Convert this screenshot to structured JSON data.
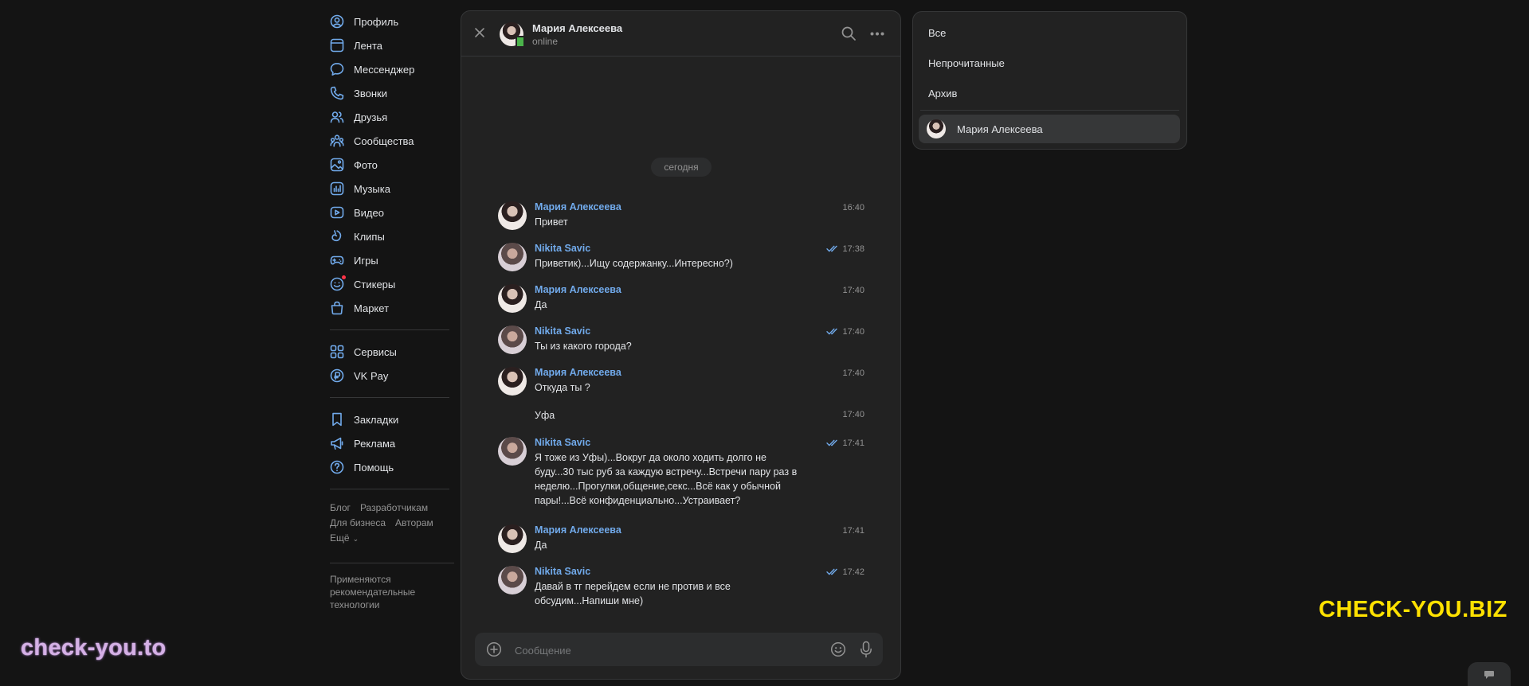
{
  "nav": {
    "items": [
      {
        "label": "Профиль",
        "icon": "profile-icon"
      },
      {
        "label": "Лента",
        "icon": "feed-icon"
      },
      {
        "label": "Мессенджер",
        "icon": "messenger-icon"
      },
      {
        "label": "Звонки",
        "icon": "phone-icon"
      },
      {
        "label": "Друзья",
        "icon": "friends-icon"
      },
      {
        "label": "Сообщества",
        "icon": "communities-icon"
      },
      {
        "label": "Фото",
        "icon": "photo-icon"
      },
      {
        "label": "Музыка",
        "icon": "music-icon"
      },
      {
        "label": "Видео",
        "icon": "video-icon"
      },
      {
        "label": "Клипы",
        "icon": "clips-icon"
      },
      {
        "label": "Игры",
        "icon": "games-icon"
      },
      {
        "label": "Стикеры",
        "icon": "stickers-icon"
      },
      {
        "label": "Маркет",
        "icon": "market-icon"
      }
    ],
    "items2": [
      {
        "label": "Сервисы",
        "icon": "services-icon"
      },
      {
        "label": "VK Pay",
        "icon": "vkpay-icon"
      }
    ],
    "items3": [
      {
        "label": "Закладки",
        "icon": "bookmark-icon"
      },
      {
        "label": "Реклама",
        "icon": "megaphone-icon"
      },
      {
        "label": "Помощь",
        "icon": "help-icon"
      }
    ],
    "footer": {
      "blog": "Блог",
      "developers": "Разработчикам",
      "business": "Для бизнеса",
      "authors": "Авторам",
      "more": "Ещё"
    },
    "recommend_note": "Применяются рекомендательные технологии"
  },
  "chat": {
    "contact_name": "Мария Алексеева",
    "status": "online",
    "date_label": "сегодня",
    "messages": [
      {
        "author": "Мария Алексеева",
        "text": "Привет",
        "time": "16:40"
      },
      {
        "author": "Nikita Savic",
        "text": "Приветик)...Ищу содержанку...Интересно?)",
        "time": "17:38"
      },
      {
        "author": "Мария Алексеева",
        "text": "Да",
        "time": "17:40"
      },
      {
        "author": "Nikita Savic",
        "text": "Ты из какого города?",
        "time": "17:40"
      },
      {
        "author": "Мария Алексеева",
        "text": "Откуда ты ?",
        "time": "17:40"
      },
      {
        "author": "",
        "text": "Уфа",
        "time": "17:40"
      },
      {
        "author": "Nikita Savic",
        "text": "Я тоже из Уфы)...Вокруг да около ходить долго не буду...30 тыс руб за каждую встречу...Встречи пару раз в неделю...Прогулки,общение,секс...Всё как у обычной пары!...Всё конфиденциально...Устраивает?",
        "time": "17:41"
      },
      {
        "author": "Мария Алексеева",
        "text": "Да",
        "time": "17:41"
      },
      {
        "author": "Nikita Savic",
        "text": "Давай в тг перейдем если не против и все обсудим...Напиши мне)",
        "time": "17:42"
      }
    ],
    "composer_placeholder": "Сообщение"
  },
  "filters": {
    "all": "Все",
    "unread": "Непрочитанные",
    "archive": "Архив",
    "conversation": "Мария Алексеева"
  },
  "watermarks": {
    "right": "CHECK-YOU.BIZ",
    "left": "check-you.to"
  },
  "colors": {
    "background": "#141414",
    "panel": "#222222",
    "accent_link": "#71aaeb",
    "online": "#4bb34b",
    "watermark_yellow": "#ffe100",
    "watermark_purple": "#d5b0e6"
  }
}
